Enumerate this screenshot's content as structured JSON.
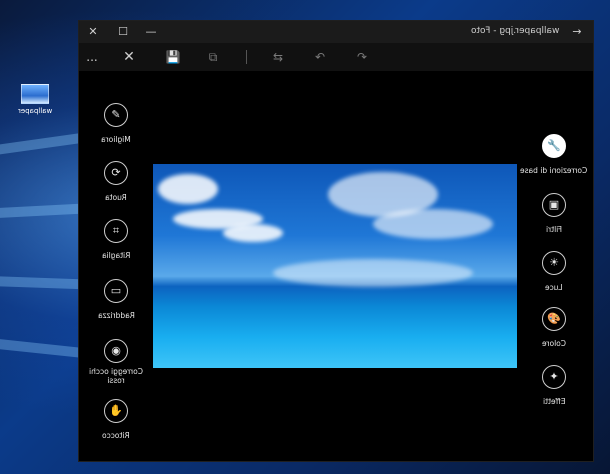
{
  "desktop": {
    "icon_label": "wallpaper"
  },
  "window": {
    "title": "wallpaper.jpg - Foto",
    "controls": {
      "close": "✕",
      "maximize": "☐",
      "minimize": "—",
      "back": "→"
    }
  },
  "toolbar": {
    "more": "...",
    "close": "✕",
    "save": "💾",
    "save_copy": "⧉",
    "compare": "⇆",
    "undo": "↶",
    "redo": "↷"
  },
  "left_tools": [
    {
      "label": "Migliora",
      "icon": "✎",
      "icon_name": "wand-icon"
    },
    {
      "label": "Ruota",
      "icon": "⟳",
      "icon_name": "rotate-icon"
    },
    {
      "label": "Ritaglia",
      "icon": "⌗",
      "icon_name": "crop-icon"
    },
    {
      "label": "Raddrizza",
      "icon": "▭",
      "icon_name": "straighten-icon"
    },
    {
      "label": "Correggi occhi rossi",
      "icon": "◉",
      "icon_name": "eye-icon"
    },
    {
      "label": "Ritocco",
      "icon": "✋",
      "icon_name": "retouch-icon"
    }
  ],
  "right_tools": [
    {
      "label": "Correzioni di base",
      "icon": "🔧",
      "icon_name": "basic-fixes-icon",
      "active": true
    },
    {
      "label": "Filtri",
      "icon": "▣",
      "icon_name": "filters-icon"
    },
    {
      "label": "Luce",
      "icon": "☀",
      "icon_name": "light-icon"
    },
    {
      "label": "Colore",
      "icon": "🎨",
      "icon_name": "color-icon"
    },
    {
      "label": "Effetti",
      "icon": "✦",
      "icon_name": "effects-icon"
    }
  ]
}
